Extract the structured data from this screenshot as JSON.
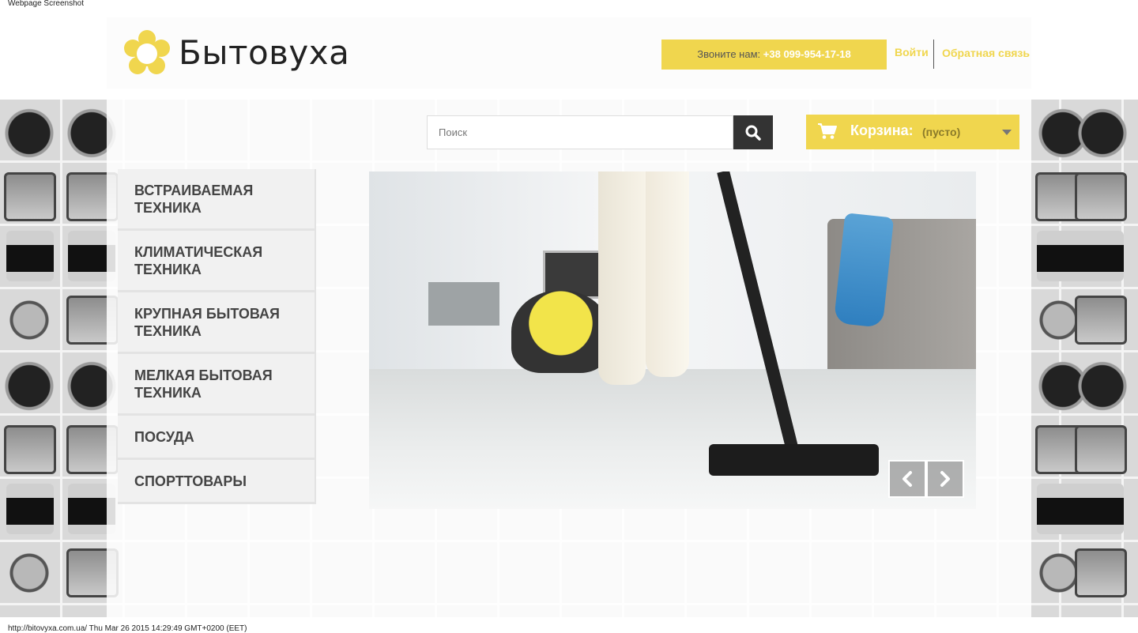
{
  "snapshot": {
    "title": "Webpage Screenshot",
    "footer": "http://bitovyxa.com.ua/ Thu Mar 26 2015 14:29:49 GMT+0200 (EET)"
  },
  "header": {
    "logo_text": "Бытовуха",
    "phone_label": "Звоните нам:",
    "phone_number": "+38 099-954-17-18",
    "login": "Войти",
    "feedback": "Обратная связь"
  },
  "search": {
    "placeholder": "Поиск",
    "button_icon": "search-icon"
  },
  "cart": {
    "icon": "cart-icon",
    "label": "Корзина:",
    "status": "(пусто)",
    "caret_icon": "chevron-down-icon"
  },
  "menu": {
    "items": [
      {
        "line1": "Встраиваемая",
        "line2": "техника"
      },
      {
        "line1": "Климатическая",
        "line2": "техника"
      },
      {
        "line1": "Крупная бытовая",
        "line2": "техника"
      },
      {
        "line1": "Мелкая бытовая",
        "line2": "техника"
      },
      {
        "line1": "Посуда",
        "line2": ""
      },
      {
        "line1": "Спорттовары",
        "line2": ""
      }
    ]
  },
  "slider": {
    "prev_icon": "chevron-left-icon",
    "next_icon": "chevron-right-icon"
  },
  "colors": {
    "accent": "#f0d64e",
    "dark": "#333333",
    "menu_bg": "#f1f1f1"
  }
}
